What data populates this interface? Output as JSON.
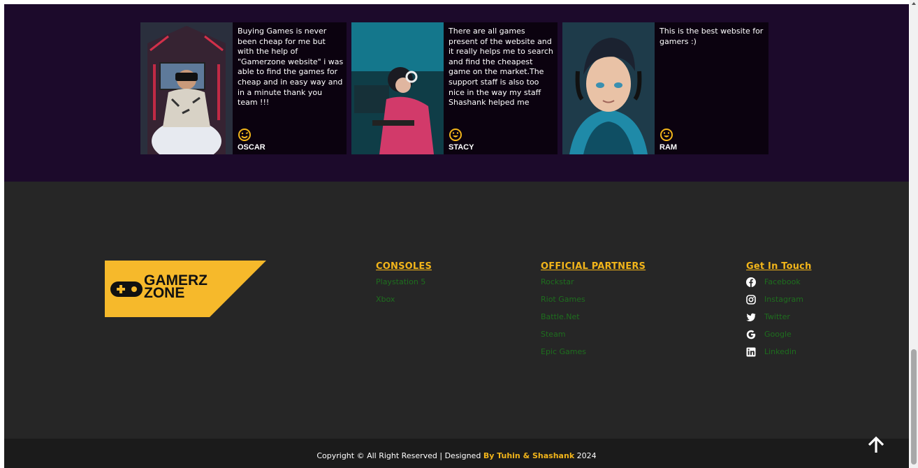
{
  "testimonials": [
    {
      "quote": "Buying Games is never been cheap for me but with the help of \"Gamerzone website\" i was able to find the games for cheap and in easy way and in a minute thank you team !!!",
      "name": "OSCAR",
      "photo_icon": "vr-gamer-photo"
    },
    {
      "quote": "There are all games present of the website and it really helps me to search and find the cheapest game on the market.The support staff is also too nice in the way my staff Shashank helped me",
      "name": "STACY",
      "photo_icon": "gamer-girl-photo"
    },
    {
      "quote": "This is the best website for gamers :)",
      "name": "RAM",
      "photo_icon": "avatar-portrait-photo"
    }
  ],
  "logo": {
    "line1": "GAMERZ",
    "line2": "ZONE",
    "icon": "gamepad-icon"
  },
  "footer": {
    "consoles": {
      "heading": "CONSOLES",
      "links": [
        "Playstation 5",
        "Xbox"
      ]
    },
    "partners": {
      "heading": "OFFICIAL PARTNERS",
      "links": [
        "Rockstar",
        "Riot Games",
        "Battle.Net",
        "Steam",
        "Epic Games"
      ]
    },
    "contact": {
      "heading": "Get In Touch",
      "links": [
        {
          "label": "Facebook",
          "icon": "facebook-icon"
        },
        {
          "label": "Instagram",
          "icon": "instagram-icon"
        },
        {
          "label": "Twitter",
          "icon": "twitter-icon"
        },
        {
          "label": "Google",
          "icon": "google-icon"
        },
        {
          "label": "Linkedin",
          "icon": "linkedin-icon"
        }
      ]
    }
  },
  "bottom": {
    "copyright_prefix": "Copyright © All Right Reserved | Designed ",
    "authors": "By Tuhin & Shashank",
    "year": " 2024"
  },
  "colors": {
    "accent": "#f2b51a",
    "link_green": "#1e6e1e",
    "testimonial_bg": "#1c0a2b",
    "footer_bg": "#262626"
  }
}
